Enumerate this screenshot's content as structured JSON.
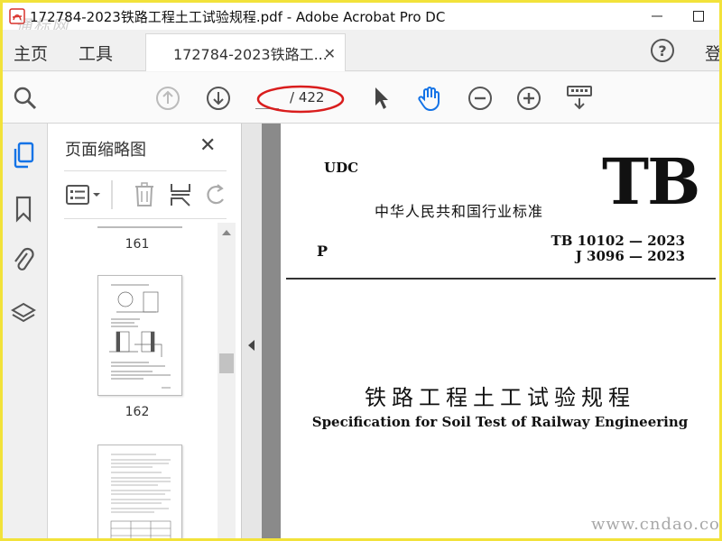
{
  "window": {
    "title": "172784-2023铁路工程土工试验规程.pdf - Adobe Acrobat Pro DC",
    "watermark_top": "通标网"
  },
  "menu": {
    "home": "主页",
    "tools": "工具",
    "doc_tab": "172784-2023铁路工...",
    "help": "?",
    "login": "登"
  },
  "toolbar": {
    "page_current": "",
    "page_total": "/ 422"
  },
  "thumbnails_pane": {
    "title": "页面缩略图",
    "pages": [
      {
        "label": "161"
      },
      {
        "label": "162"
      }
    ]
  },
  "document": {
    "udc": "UDC",
    "logo": "TB",
    "standard_cn": "中华人民共和国行业标准",
    "p_mark": "P",
    "std_number_1": "TB  10102 — 2023",
    "std_number_2": "J 3096 — 2023",
    "title_cn": "铁路工程土工试验规程",
    "title_en": "Specification for Soil Test of Railway Engineering"
  },
  "watermark_bottom": "www.cndao.com",
  "colors": {
    "frame": "#f2e23a",
    "accent_blue": "#1473e6",
    "annotation_red": "#d91d1d"
  }
}
